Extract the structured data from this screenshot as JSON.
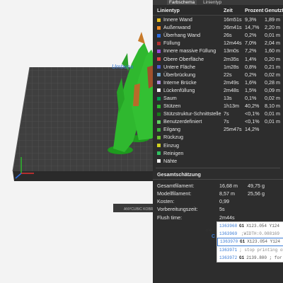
{
  "viewport": {
    "bed_label": "Umbena"
  },
  "panel": {
    "tabs": [
      "Farbschema",
      "Linientyp"
    ],
    "columns": [
      "Linientyp",
      "Zeit",
      "Prozent",
      "Genutzte"
    ],
    "rows": [
      {
        "name": "Innere Wand",
        "time": "16m51s",
        "pct": "9,3%",
        "len": "1,89 m",
        "color": "#e8c020"
      },
      {
        "name": "Außenwand",
        "time": "26m41s",
        "pct": "14,7%",
        "len": "2,20 m",
        "color": "#f08a24"
      },
      {
        "name": "Überhang Wand",
        "time": "26s",
        "pct": "0,2%",
        "len": "0,01 m",
        "color": "#2d6cdf"
      },
      {
        "name": "Füllung",
        "time": "12m44s",
        "pct": "7,0%",
        "len": "2,04 m",
        "color": "#b03030"
      },
      {
        "name": "Innere massive Füllung",
        "time": "13m0s",
        "pct": "7,2%",
        "len": "1,60 m",
        "color": "#9a4ad8"
      },
      {
        "name": "Obere Oberfläche",
        "time": "2m35s",
        "pct": "1,4%",
        "len": "0,20 m",
        "color": "#e04040"
      },
      {
        "name": "Untere Fläche",
        "time": "1m28s",
        "pct": "0,8%",
        "len": "0,21 m",
        "color": "#4a5ad0"
      },
      {
        "name": "Überbrückung",
        "time": "22s",
        "pct": "0,2%",
        "len": "0,02 m",
        "color": "#6aa0c8"
      },
      {
        "name": "Interne Brücke",
        "time": "2m49s",
        "pct": "1,6%",
        "len": "0,28 m",
        "color": "#a88ad8"
      },
      {
        "name": "Lückenfüllung",
        "time": "2m48s",
        "pct": "1,5%",
        "len": "0,09 m",
        "color": "#f0f0f0"
      },
      {
        "name": "Saum",
        "time": "13s",
        "pct": "0,1%",
        "len": "0,02 m",
        "color": "#00a050"
      },
      {
        "name": "Stützen",
        "time": "1h13m",
        "pct": "40,2%",
        "len": "8,10 m",
        "color": "#2fb82f"
      },
      {
        "name": "Stützstruktur-Schnittstelle",
        "time": "7s",
        "pct": "<0,1%",
        "len": "0,01 m",
        "color": "#1a7a1a"
      },
      {
        "name": "Benutzerdefiniert",
        "time": "7s",
        "pct": "<0,1%",
        "len": "0,01 m",
        "color": "#60d060"
      },
      {
        "name": "Eilgang",
        "time": "25m47s",
        "pct": "14,2%",
        "len": "",
        "color": "#3db03d"
      },
      {
        "name": "Rückzug",
        "time": "",
        "pct": "",
        "len": "",
        "color": "#70c030"
      },
      {
        "name": "Einzug",
        "time": "",
        "pct": "",
        "len": "",
        "color": "#d0d020"
      },
      {
        "name": "Reinigen",
        "time": "",
        "pct": "",
        "len": "",
        "color": "#30c060"
      },
      {
        "name": "Nähte",
        "time": "",
        "pct": "",
        "len": "",
        "color": "#f0f0f0"
      }
    ],
    "summary_title": "Gesamtschätzung",
    "summary": [
      {
        "label": "Gesamtfilament:",
        "v1": "16,68 m",
        "v2": "49,75 g"
      },
      {
        "label": "Modellfilament:",
        "v1": "8,57 m",
        "v2": "25,56 g"
      },
      {
        "label": "Kosten:",
        "v1": "0,99",
        "v2": ""
      },
      {
        "label": "Vorbereitungszeit:",
        "v1": "5s",
        "v2": ""
      },
      {
        "label": "Flush time:",
        "v1": "2m44s",
        "v2": ""
      }
    ]
  },
  "gcode": [
    {
      "num": "1363968",
      "cmd": "G1",
      "args": "X123.054 Y124",
      "sel": false,
      "cmt": false
    },
    {
      "num": "1363969",
      "cmd": "",
      "args": ";WIDTH:0.088169",
      "sel": false,
      "cmt": true
    },
    {
      "num": "1363970",
      "cmd": "G1",
      "args": "X123.054 Y124",
      "sel": true,
      "cmt": false
    },
    {
      "num": "1363971",
      "cmd": "",
      "args": "; stop printing obj",
      "sel": false,
      "cmt": true
    },
    {
      "num": "1363972",
      "cmd": "G1",
      "args": "2139.800 ; for",
      "sel": false,
      "cmt": false
    }
  ],
  "edge_label": "me",
  "edge_c": "C"
}
